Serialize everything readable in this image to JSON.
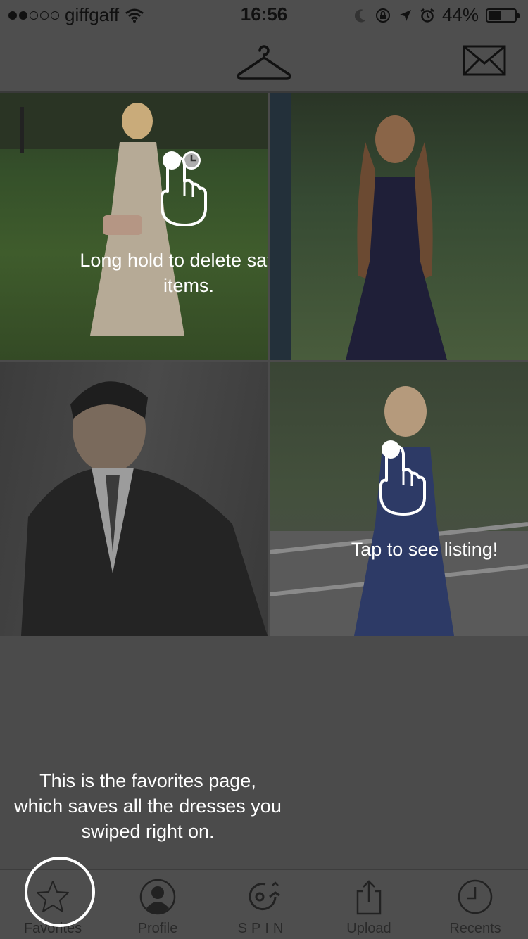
{
  "status_bar": {
    "carrier": "giffgaff",
    "time": "16:56",
    "battery": "44%"
  },
  "grid": {
    "hold_hint": "Long hold to delete saved items.",
    "tap_hint": "Tap to see listing!"
  },
  "caption": "This is the favorites page, which saves all the dresses you swiped right on.",
  "tabs": [
    {
      "label": "Favorites",
      "icon": "star-icon"
    },
    {
      "label": "Profile",
      "icon": "person-icon"
    },
    {
      "label": "SPIN",
      "icon": "spin-icon"
    },
    {
      "label": "Upload",
      "icon": "share-icon"
    },
    {
      "label": "Recents",
      "icon": "clock-icon"
    }
  ]
}
